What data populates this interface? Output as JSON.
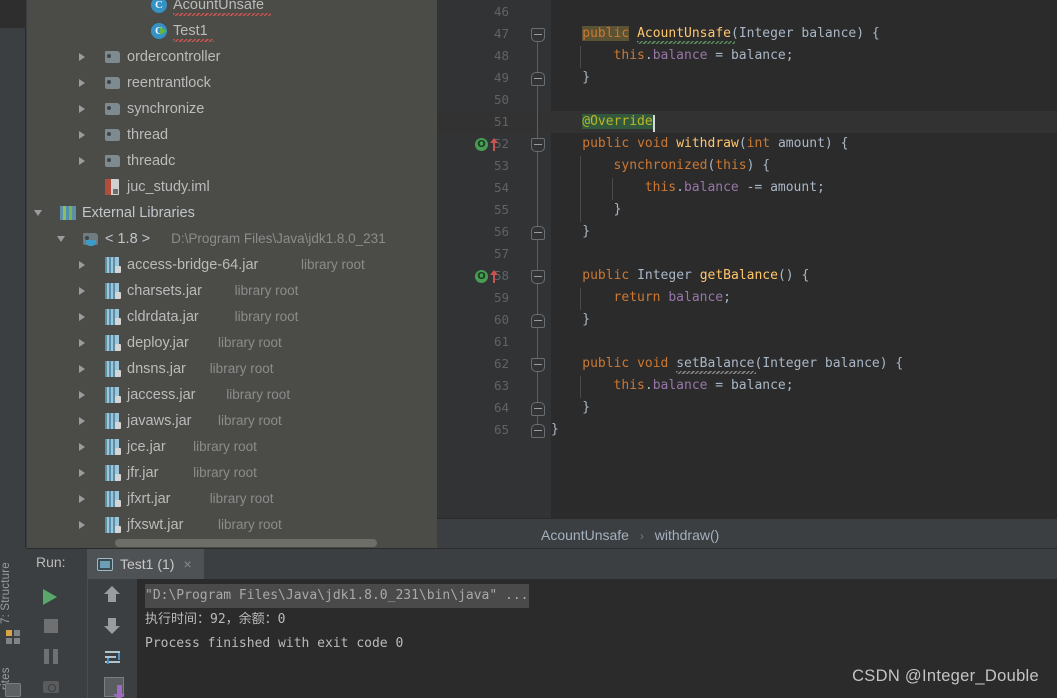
{
  "left_strip": {
    "structure_label": "7: Structure",
    "favorites_label": "rites",
    "structure_icon": "structure-icon",
    "favorites_icon": "favorites-icon"
  },
  "project_tree": {
    "items": [
      {
        "label": "AcountUnsafe",
        "icon": "java-class-icon",
        "indent": 124,
        "arrow": "none",
        "error": true,
        "kind": "class",
        "partial": true
      },
      {
        "label": "Test1",
        "icon": "java-runnable-class-icon",
        "indent": 124,
        "arrow": "none",
        "error": true,
        "kind": "runclass"
      },
      {
        "label": "ordercontroller",
        "icon": "folder-icon",
        "indent": 78,
        "arrow": "right",
        "kind": "folder"
      },
      {
        "label": "reentrantlock",
        "icon": "folder-icon",
        "indent": 78,
        "arrow": "right",
        "kind": "folder"
      },
      {
        "label": "synchronize",
        "icon": "folder-icon",
        "indent": 78,
        "arrow": "right",
        "kind": "folder"
      },
      {
        "label": "thread",
        "icon": "folder-icon",
        "indent": 78,
        "arrow": "right",
        "kind": "folder"
      },
      {
        "label": "threadc",
        "icon": "folder-icon",
        "indent": 78,
        "arrow": "right",
        "kind": "folder"
      },
      {
        "label": "juc_study.iml",
        "icon": "iml-file-icon",
        "indent": 78,
        "arrow": "none",
        "kind": "iml"
      },
      {
        "label": "External Libraries",
        "icon": "external-libraries-icon",
        "indent": 33,
        "arrow": "down",
        "kind": "extlib"
      },
      {
        "label": "< 1.8 >",
        "sub": "D:\\Program Files\\Java\\jdk1.8.0_231",
        "icon": "sdk-folder-icon",
        "indent": 56,
        "arrow": "down",
        "kind": "sdk"
      },
      {
        "label": "access-bridge-64.jar",
        "sub": "library root",
        "icon": "jar-icon",
        "indent": 78,
        "arrow": "right",
        "kind": "jar"
      },
      {
        "label": "charsets.jar",
        "sub": "library root",
        "icon": "jar-icon",
        "indent": 78,
        "arrow": "right",
        "kind": "jar"
      },
      {
        "label": "cldrdata.jar",
        "sub": "library root",
        "icon": "jar-icon",
        "indent": 78,
        "arrow": "right",
        "kind": "jar"
      },
      {
        "label": "deploy.jar",
        "sub": "library root",
        "icon": "jar-icon",
        "indent": 78,
        "arrow": "right",
        "kind": "jar"
      },
      {
        "label": "dnsns.jar",
        "sub": "library root",
        "icon": "jar-icon",
        "indent": 78,
        "arrow": "right",
        "kind": "jar"
      },
      {
        "label": "jaccess.jar",
        "sub": "library root",
        "icon": "jar-icon",
        "indent": 78,
        "arrow": "right",
        "kind": "jar"
      },
      {
        "label": "javaws.jar",
        "sub": "library root",
        "icon": "jar-icon",
        "indent": 78,
        "arrow": "right",
        "kind": "jar"
      },
      {
        "label": "jce.jar",
        "sub": "library root",
        "icon": "jar-icon",
        "indent": 78,
        "arrow": "right",
        "kind": "jar"
      },
      {
        "label": "jfr.jar",
        "sub": "library root",
        "icon": "jar-icon",
        "indent": 78,
        "arrow": "right",
        "kind": "jar"
      },
      {
        "label": "jfxrt.jar",
        "sub": "library root",
        "icon": "jar-icon",
        "indent": 78,
        "arrow": "right",
        "kind": "jar"
      },
      {
        "label": "jfxswt.jar",
        "sub": "library root",
        "icon": "jar-icon",
        "indent": 78,
        "arrow": "right",
        "kind": "jar"
      }
    ]
  },
  "editor": {
    "first_line_number": 46,
    "lines": [
      {
        "n": 46,
        "text": ""
      },
      {
        "n": 47,
        "text": "    public AcountUnsafe(Integer balance) {"
      },
      {
        "n": 48,
        "text": "        this.balance = balance;"
      },
      {
        "n": 49,
        "text": "    }"
      },
      {
        "n": 50,
        "text": ""
      },
      {
        "n": 51,
        "text": "    @Override"
      },
      {
        "n": 52,
        "text": "    public void withdraw(int amount) {"
      },
      {
        "n": 53,
        "text": "        synchronized(this) {"
      },
      {
        "n": 54,
        "text": "            this.balance -= amount;"
      },
      {
        "n": 55,
        "text": "        }"
      },
      {
        "n": 56,
        "text": "    }"
      },
      {
        "n": 57,
        "text": ""
      },
      {
        "n": 58,
        "text": "    public Integer getBalance() {"
      },
      {
        "n": 59,
        "text": "        return balance;"
      },
      {
        "n": 60,
        "text": "    }"
      },
      {
        "n": 61,
        "text": ""
      },
      {
        "n": 62,
        "text": "    public void setBalance(Integer balance) {"
      },
      {
        "n": 63,
        "text": "        this.balance = balance;"
      },
      {
        "n": 64,
        "text": "    }"
      },
      {
        "n": 65,
        "text": "}"
      }
    ],
    "tokens": {
      "t47": [
        {
          "t": "public",
          "c": "k idhl"
        },
        {
          "t": " ",
          "c": "pn"
        },
        {
          "t": "AcountUnsafe",
          "c": "fn"
        },
        {
          "t": "(",
          "c": "pn"
        },
        {
          "t": "Integer",
          "c": "pn"
        },
        {
          "t": " balance) {",
          "c": "pn"
        }
      ],
      "t48": [
        {
          "t": "this",
          "c": "k"
        },
        {
          "t": ".",
          "c": "pn"
        },
        {
          "t": "balance",
          "c": "fld"
        },
        {
          "t": " = balance;",
          "c": "pn"
        }
      ],
      "t51": [
        {
          "t": "@Override",
          "c": "an warnbg"
        }
      ],
      "t52": [
        {
          "t": "public",
          "c": "k"
        },
        {
          "t": " ",
          "c": "pn"
        },
        {
          "t": "void",
          "c": "k"
        },
        {
          "t": " ",
          "c": "pn"
        },
        {
          "t": "withdraw",
          "c": "fn"
        },
        {
          "t": "(",
          "c": "pn"
        },
        {
          "t": "int",
          "c": "k"
        },
        {
          "t": " amount) {",
          "c": "pn"
        }
      ],
      "t53": [
        {
          "t": "synchronized",
          "c": "k"
        },
        {
          "t": "(",
          "c": "pn"
        },
        {
          "t": "this",
          "c": "k"
        },
        {
          "t": ") {",
          "c": "pn"
        }
      ],
      "t54": [
        {
          "t": "this",
          "c": "k"
        },
        {
          "t": ".",
          "c": "pn"
        },
        {
          "t": "balance",
          "c": "fld"
        },
        {
          "t": " -= amount;",
          "c": "pn"
        }
      ],
      "t58": [
        {
          "t": "public",
          "c": "k"
        },
        {
          "t": " ",
          "c": "pn"
        },
        {
          "t": "Integer",
          "c": "pn"
        },
        {
          "t": " ",
          "c": "pn"
        },
        {
          "t": "getBalance",
          "c": "fn"
        },
        {
          "t": "() {",
          "c": "pn"
        }
      ],
      "t59": [
        {
          "t": "return",
          "c": "k"
        },
        {
          "t": " ",
          "c": "pn"
        },
        {
          "t": "balance",
          "c": "fld"
        },
        {
          "t": ";",
          "c": "pn"
        }
      ],
      "t62": [
        {
          "t": "public",
          "c": "k"
        },
        {
          "t": " ",
          "c": "pn"
        },
        {
          "t": "void",
          "c": "k"
        },
        {
          "t": " ",
          "c": "pn"
        },
        {
          "t": "setBalance",
          "c": "pn"
        },
        {
          "t": "(",
          "c": "pn"
        },
        {
          "t": "Integer",
          "c": "pn"
        },
        {
          "t": " balance) {",
          "c": "pn"
        }
      ],
      "t63": [
        {
          "t": "this",
          "c": "k"
        },
        {
          "t": ".",
          "c": "pn"
        },
        {
          "t": "balance",
          "c": "fld"
        },
        {
          "t": " = balance;",
          "c": "pn"
        }
      ]
    },
    "gutter_markers": [
      {
        "line": 52,
        "icon": "override-method-icon",
        "badge": "O"
      },
      {
        "line": 58,
        "icon": "override-method-icon",
        "badge": "O"
      }
    ],
    "current_line": 51,
    "caret_line": 51
  },
  "breadcrumb": {
    "class": "AcountUnsafe",
    "separator": "›",
    "method": "withdraw()"
  },
  "run_panel": {
    "run_label": "Run:",
    "tab_title": "Test1 (1)",
    "tab_close": "×",
    "tab_icon": "run-configuration-icon",
    "toolbar": [
      {
        "name": "rerun-button",
        "icon": "play-icon"
      },
      {
        "name": "stop-button",
        "icon": "stop-icon"
      },
      {
        "name": "pause-button",
        "icon": "pause-icon"
      },
      {
        "name": "dump-threads-button",
        "icon": "camera-icon"
      },
      {
        "name": "prev-occurrence-button",
        "icon": "arrow-up-icon"
      },
      {
        "name": "next-occurrence-button",
        "icon": "arrow-down-icon"
      },
      {
        "name": "soft-wrap-button",
        "icon": "soft-wrap-icon"
      },
      {
        "name": "scroll-to-end-button",
        "icon": "scroll-down-icon"
      }
    ],
    "console_lines": [
      {
        "text": "\"D:\\Program Files\\Java\\jdk1.8.0_231\\bin\\java\" ...",
        "selected": true
      },
      {
        "text": "执行时间：92，余额：0",
        "selected": false
      },
      {
        "text": "Process finished with exit code 0",
        "selected": false
      }
    ]
  },
  "watermark": {
    "text": "CSDN @Integer_Double"
  },
  "colors": {
    "editor_bg": "#2b2b2b",
    "gutter_bg": "#313335",
    "tree_bg": "#4b4b47",
    "panel_bg": "#3c3f41",
    "keyword": "#cc7832",
    "method": "#ffc66d",
    "field": "#9876aa",
    "annotation": "#bbb529",
    "run_green": "#59a869"
  }
}
